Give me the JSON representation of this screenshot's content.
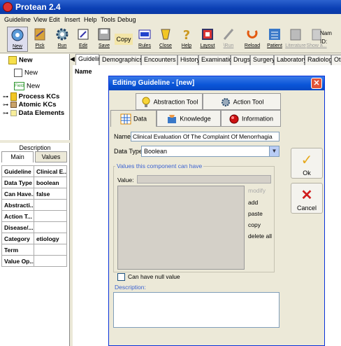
{
  "app": {
    "title": "Protean 2.4"
  },
  "menu": [
    "Guideline",
    "View",
    "Edit",
    "Insert",
    "Help",
    "Tools",
    "Debug"
  ],
  "toolbar": [
    {
      "label": "New",
      "icon": "new-icon"
    },
    {
      "label": "Pick",
      "icon": "pick-icon"
    },
    {
      "label": "Run",
      "icon": "run-gear-icon"
    },
    {
      "label": "Edit",
      "icon": "edit-icon"
    },
    {
      "label": "Save",
      "icon": "save-disk-icon"
    },
    {
      "label": "Copy",
      "icon": "copy-icon"
    },
    {
      "label": "Rules",
      "icon": "rules-icon"
    },
    {
      "label": "Close",
      "icon": "close-icon"
    },
    {
      "label": "Help",
      "icon": "help-icon"
    },
    {
      "label": "Layout",
      "icon": "layout-icon"
    },
    {
      "label": "\\Run",
      "icon": "wand-icon"
    },
    {
      "label": "Reload",
      "icon": "reload-icon"
    },
    {
      "label": "Patient",
      "icon": "patient-icon"
    },
    {
      "label": "Literature",
      "icon": "book-icon"
    },
    {
      "label": "Show a...",
      "icon": "show-icon"
    }
  ],
  "rightinfo": {
    "line1": "Nam",
    "line2": "ID:"
  },
  "tree": [
    {
      "label": "New",
      "icon": "yellow-note-icon"
    },
    {
      "label": "New",
      "icon": "blank-box-icon"
    },
    {
      "label": "New",
      "icon": "field-icon"
    },
    {
      "label": "Process KCs",
      "icon": "process-kc-icon"
    },
    {
      "label": "Atomic KCs",
      "icon": "atomic-kc-icon"
    },
    {
      "label": "Data Elements",
      "icon": "data-elements-icon"
    }
  ],
  "field_icon_text": "Field",
  "leftpanel": {
    "description_label": "Description",
    "tabs": [
      "Main",
      "Values"
    ],
    "props": [
      {
        "k": "Guideline",
        "v": "Clinical E..."
      },
      {
        "k": "Data Type",
        "v": "boolean"
      },
      {
        "k": "Can Have...",
        "v": "false"
      },
      {
        "k": "Abstracti...",
        "v": ""
      },
      {
        "k": "Action T...",
        "v": ""
      },
      {
        "k": "Disease/...",
        "v": ""
      },
      {
        "k": "Category",
        "v": "etiology"
      },
      {
        "k": "Term",
        "v": ""
      },
      {
        "k": "Value Op...",
        "v": ""
      }
    ]
  },
  "main_tabs": [
    "Guideline",
    "Demographics",
    "Encounters",
    "History",
    "Examination",
    "Drugs",
    "Surgery",
    "Laboratory",
    "Radiology",
    "Othe"
  ],
  "main_name_label": "Name",
  "dialog": {
    "title": "Editing Guideline - [new]",
    "close_glyph": "✕",
    "tabs_top": [
      {
        "label": "Abstraction Tool",
        "icon": "lightbulb-icon"
      },
      {
        "label": "Action Tool",
        "icon": "gear-icon"
      }
    ],
    "tabs_bottom": [
      {
        "label": "Data",
        "icon": "data-grid-icon"
      },
      {
        "label": "Knowledge",
        "icon": "knowledge-icon"
      },
      {
        "label": "Information",
        "icon": "info-ball-icon"
      }
    ],
    "name_label": "Name",
    "name_value": "Clinical Evaluation Of The Complaint Of Menorrhagia",
    "datatype_label": "Data Type",
    "datatype_value": "Boolean",
    "values_group_label": "Values this component can have",
    "value_label": "Value:",
    "actions": [
      {
        "label": "modify",
        "disabled": true
      },
      {
        "label": "add",
        "disabled": false
      },
      {
        "label": "paste",
        "disabled": false
      },
      {
        "label": "copy",
        "disabled": false
      },
      {
        "label": "delete all",
        "disabled": false
      }
    ],
    "null_label": "Can have null value",
    "null_checked": false,
    "description_label": "Description:",
    "ok_label": "Ok",
    "cancel_label": "Cancel"
  },
  "colors": {
    "titlebar": "#0a3fb4",
    "dialog_titlebar": "#0a55d8",
    "close_red": "#e2553a",
    "link_blue": "#3b62d1"
  }
}
